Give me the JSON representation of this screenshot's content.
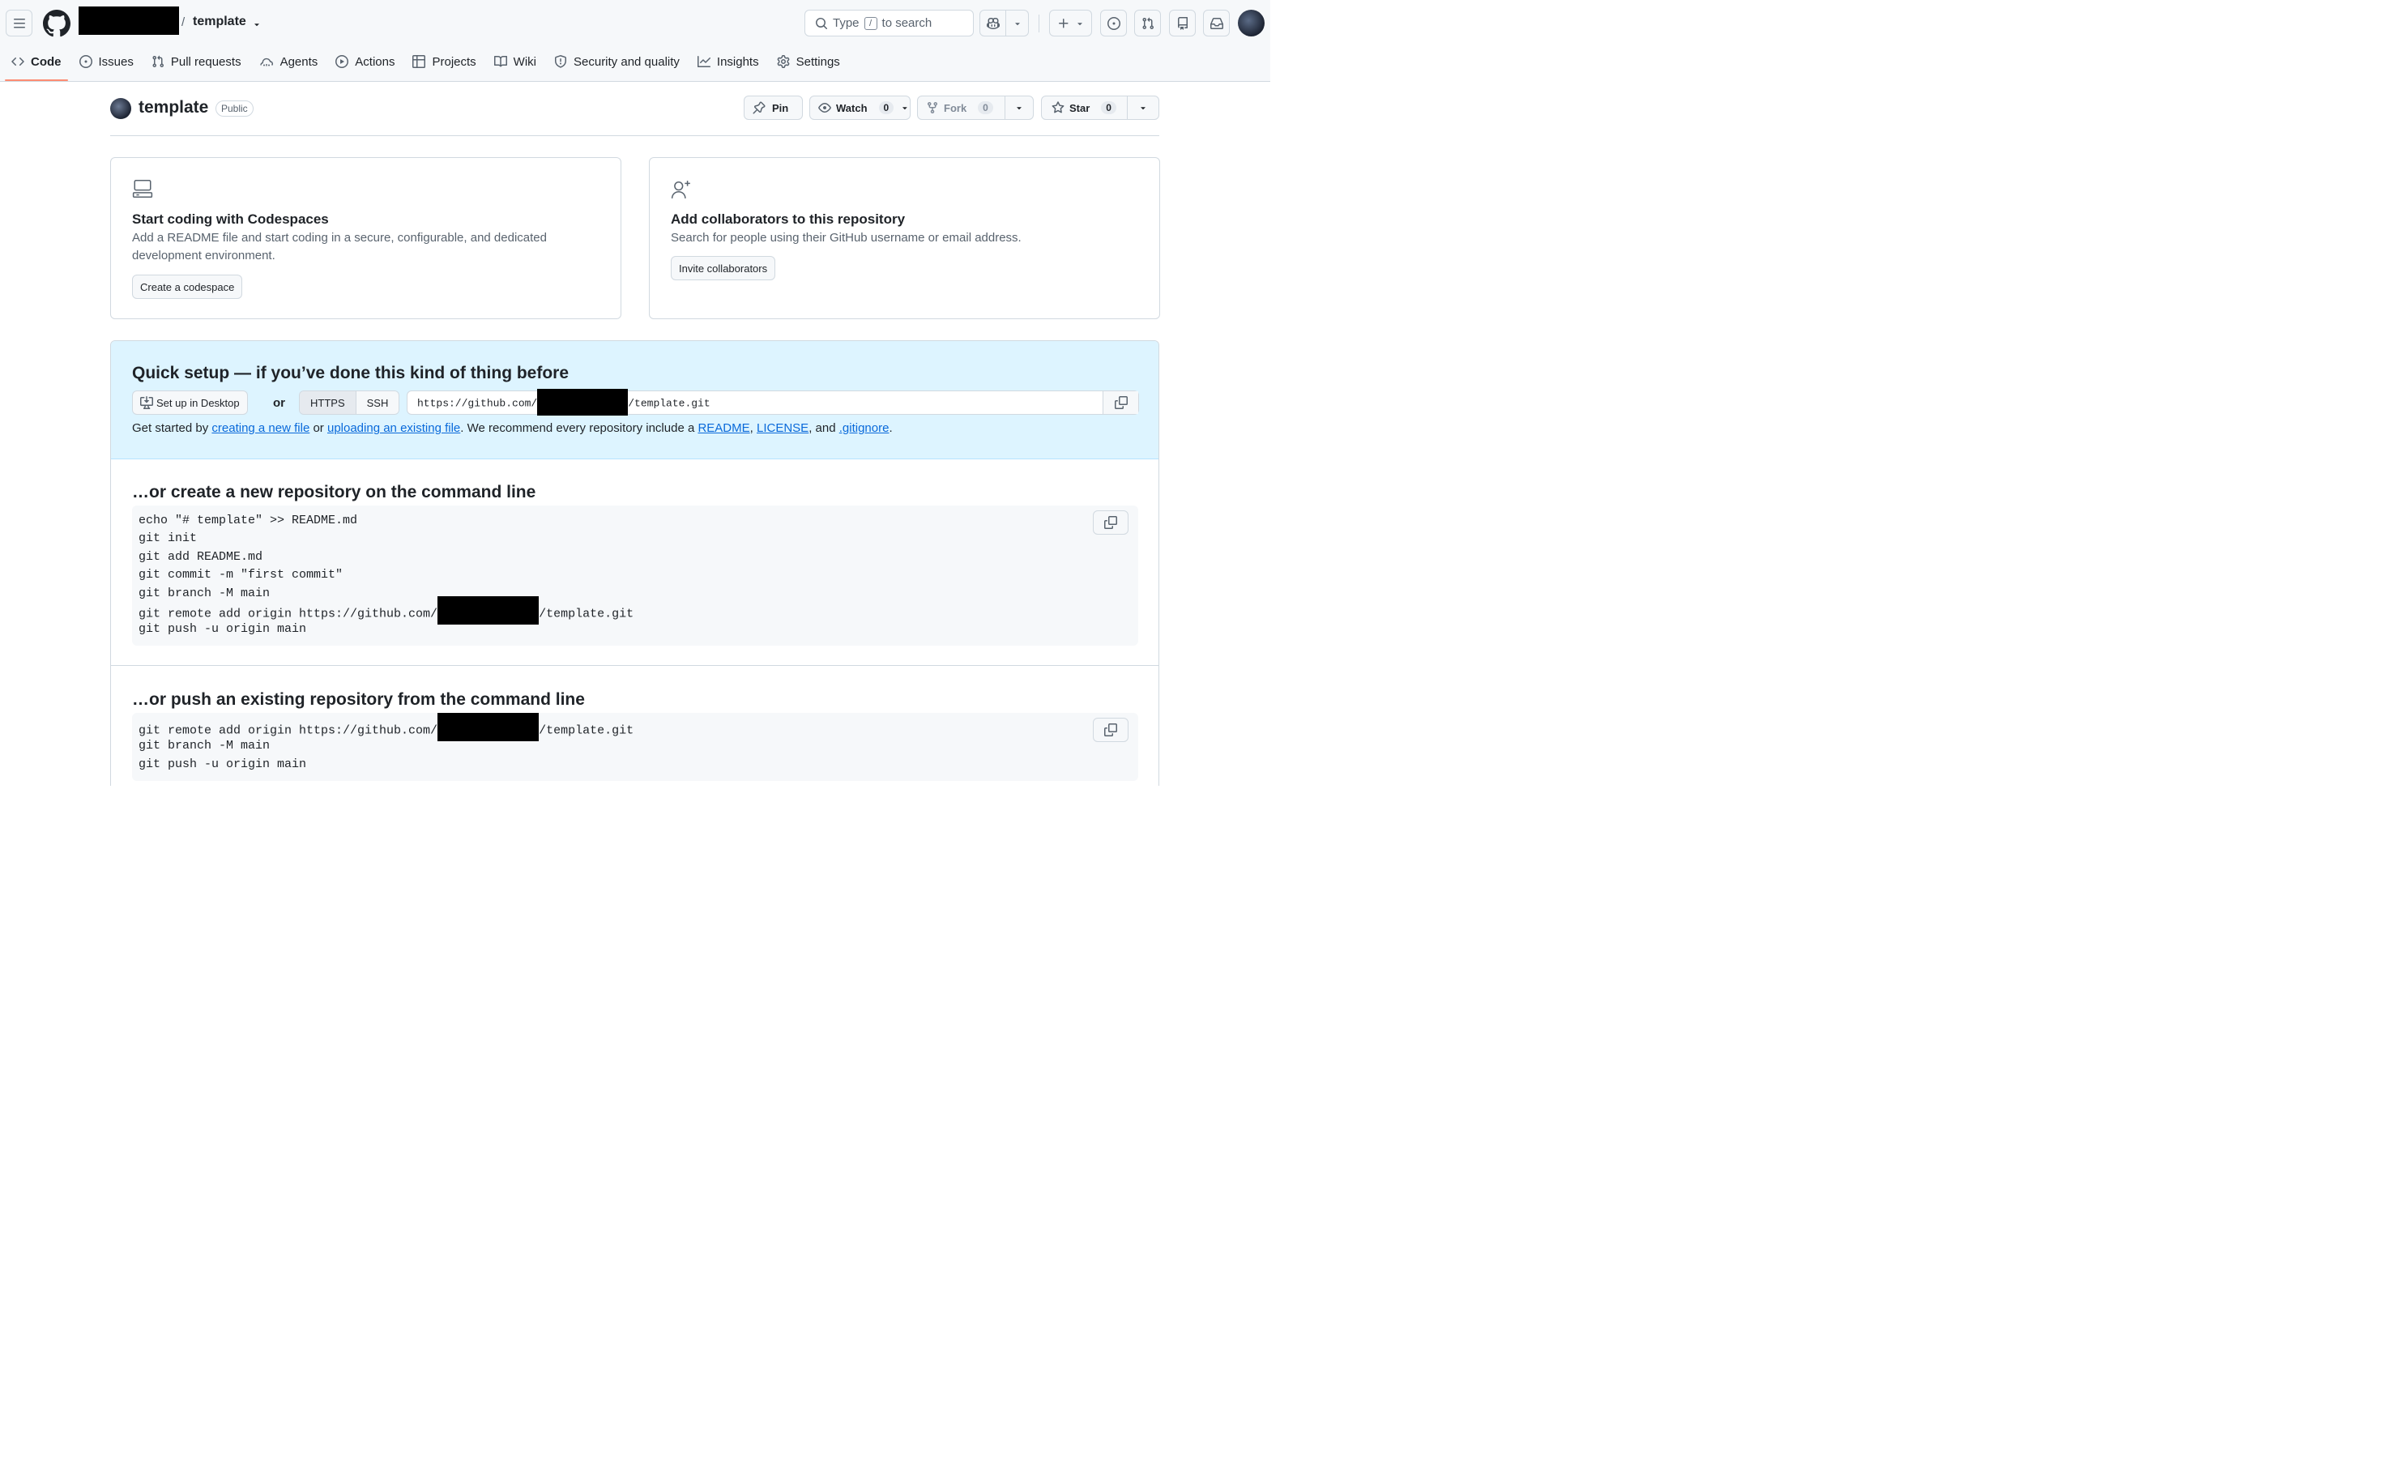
{
  "header": {
    "repo_name": "template",
    "slash": "/",
    "search_prefix": "Type",
    "search_key": "/",
    "search_suffix": "to search"
  },
  "tabs": [
    {
      "label": "Code",
      "icon": "code-icon",
      "active": true
    },
    {
      "label": "Issues",
      "icon": "issue-icon"
    },
    {
      "label": "Pull requests",
      "icon": "pull-request-icon"
    },
    {
      "label": "Agents",
      "icon": "agents-icon"
    },
    {
      "label": "Actions",
      "icon": "play-icon"
    },
    {
      "label": "Projects",
      "icon": "table-icon"
    },
    {
      "label": "Wiki",
      "icon": "book-icon"
    },
    {
      "label": "Security and quality",
      "icon": "shield-icon"
    },
    {
      "label": "Insights",
      "icon": "graph-icon"
    },
    {
      "label": "Settings",
      "icon": "gear-icon"
    }
  ],
  "repo": {
    "name": "template",
    "visibility": "Public",
    "pin_label": "Pin",
    "watch_label": "Watch",
    "watch_count": "0",
    "fork_label": "Fork",
    "fork_count": "0",
    "star_label": "Star",
    "star_count": "0"
  },
  "cards": {
    "codespaces": {
      "title": "Start coding with Codespaces",
      "text": "Add a README file and start coding in a secure, configurable, and dedicated development environment.",
      "button": "Create a codespace"
    },
    "collaborators": {
      "title": "Add collaborators to this repository",
      "text": "Search for people using their GitHub username or email address.",
      "button": "Invite collaborators"
    }
  },
  "quick_setup": {
    "title": "Quick setup — if you’ve done this kind of thing before",
    "desktop_button": "Set up in Desktop",
    "or": "or",
    "https": "HTTPS",
    "ssh": "SSH",
    "url_prefix": "https://github.com/",
    "url_suffix": "/template.git",
    "hint_start": "Get started by",
    "link_new_file": "creating a new file",
    "hint_or": "or",
    "link_upload": "uploading an existing file",
    "hint_mid": ". We recommend every repository include a",
    "link_readme": "README",
    "hint_comma": ",",
    "link_license": "LICENSE",
    "hint_and": ", and",
    "link_gitignore": ".gitignore",
    "hint_end": "."
  },
  "new_repo": {
    "title": "…or create a new repository on the command line",
    "lines": [
      "echo \"# template\" >> README.md",
      "git init",
      "git add README.md",
      "git commit -m \"first commit\"",
      "git branch -M main",
      "git remote add origin https://github.com/",
      "git push -u origin main"
    ],
    "remote_suffix": "/template.git"
  },
  "push_repo": {
    "title": "…or push an existing repository from the command line",
    "lines": [
      "git remote add origin https://github.com/",
      "git branch -M main",
      "git push -u origin main"
    ],
    "remote_suffix": "/template.git"
  }
}
